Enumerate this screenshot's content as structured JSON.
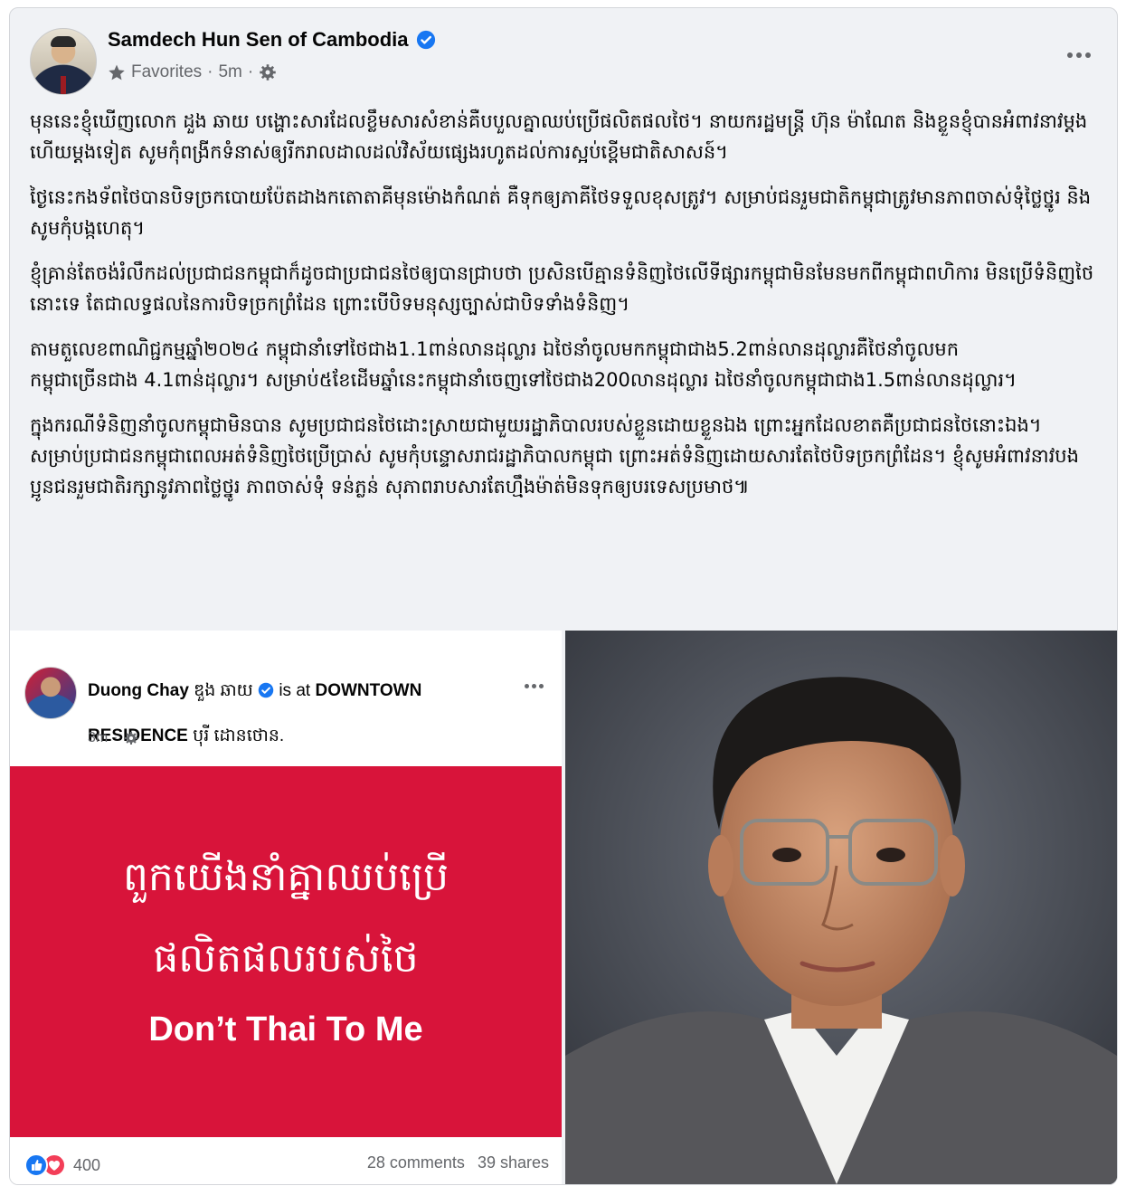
{
  "post": {
    "author": "Samdech Hun Sen of Cambodia",
    "audience": "Favorites",
    "separator": "·",
    "time": "5m",
    "paragraphs": [
      "មុននេះខ្ញុំឃើញលោក ដួង ឆាយ បង្ហោះសារដែលខ្លឹមសារសំខាន់គឺបបួលគ្នាឈប់ប្រើផលិតផលថៃ។ នាយករដ្ឋមន្ត្រី ហ៊ុន ម៉ាណែត និងខ្លួនខ្ញុំបានអំពាវនាវម្តងហើយម្តងទៀត សូមកុំពង្រីកទំនាស់ឲ្យរីករាលដាលដល់វិស័យផ្សេងរហូតដល់ការស្អប់ខ្ពើមជាតិសាសន៍។",
      "ថ្ងៃនេះកងទ័ពថៃបានបិទច្រកបោយប៉ែតដាងកតោតាគីមុនម៉ោងកំណត់ គឺទុកឲ្យភាគីថៃទទួលខុសត្រូវ។ សម្រាប់ជនរួមជាតិកម្ពុជាត្រូវមានភាពចាស់ទុំថ្លៃថ្នូរ និងសូមកុំបង្កហេតុ។",
      "ខ្ញុំគ្រាន់តែចង់រំលឹកដល់ប្រជាជនកម្ពុជាក៏ដូចជាប្រជាជនថៃឲ្យបានជ្រាបថា ប្រសិនបើគ្មានទំនិញថៃលើទីផ្សារកម្ពុជាមិនមែនមកពីកម្ពុជាពហិការ មិនប្រើទំនិញថៃនោះទេ តែជាលទ្ធផលនៃការបិទច្រកព្រំដែន ព្រោះបើបិទមនុស្សច្បាស់ជាបិទទាំងទំនិញ។",
      "តាមតួលេខពាណិជ្ជកម្មឆ្នាំ២០២៤ កម្ពុជានាំទៅថៃជាង1.1ពាន់លានដុល្លារ ឯថៃនាំចូលមកកម្ពុជាជាង5.2ពាន់លានដុល្លារគឺថៃនាំចូលមក\nកម្ពុជាច្រើនជាង 4.1ពាន់ដុល្លារ។ សម្រាប់៥ខែដើមឆ្នាំនេះកម្ពុជានាំចេញទៅថៃជាង200លានដុល្លារ ឯថៃនាំចូលកម្ពុជាជាង1.5ពាន់លានដុល្លារ។",
      "ក្នុងករណីទំនិញនាំចូលកម្ពុជាមិនបាន សូមប្រជាជនថៃដោះស្រាយជាមួយរដ្ឋាភិបាលរបស់ខ្លួនដោយខ្លួនឯង ព្រោះអ្នកដែលខាតគឺប្រជាជនថៃនោះឯង។\nសម្រាប់ប្រជាជនកម្ពុជាពេលអត់ទំនិញថៃប្រើប្រាស់ សូមកុំបន្ទោសរាជរដ្ឋាភិបាលកម្ពុជា ព្រោះអត់ទំនិញដោយសារតែថៃបិទច្រកព្រំដែន។ ខ្ញុំសូមអំពាវនាវបងប្អូនជនរួមជាតិរក្សានូវភាពថ្លៃថ្នូរ ភាពចាស់ទុំ ទន់ភ្លន់ សុភាពរាបសារតែហ្មឹងម៉ាត់មិនទុកឲ្យបរទេសប្រមាថ៕"
    ]
  },
  "shared": {
    "name": "Duong Chay",
    "name_khmer": "ឌួង ឆាយ",
    "is_at": "is at",
    "place": "DOWNTOWN RESIDENCE",
    "place_suffix": "បុរី ដោនថោន.",
    "time": "3m",
    "banner_line1": "ពួកយើងនាំគ្នាឈប់ប្រើ",
    "banner_line2": "ផលិតផលរបស់ថៃ",
    "banner_line3": "Don’t Thai To Me",
    "reaction_count": "400",
    "comments": "28 comments",
    "shares": "39 shares"
  },
  "colors": {
    "banner_red": "#d8143a",
    "verified_blue": "#1877f2",
    "meta_gray": "#65676b"
  },
  "icons": [
    "star-icon",
    "gear-icon",
    "verified-badge-icon",
    "more-options-icon",
    "like-reaction-icon",
    "love-reaction-icon"
  ]
}
